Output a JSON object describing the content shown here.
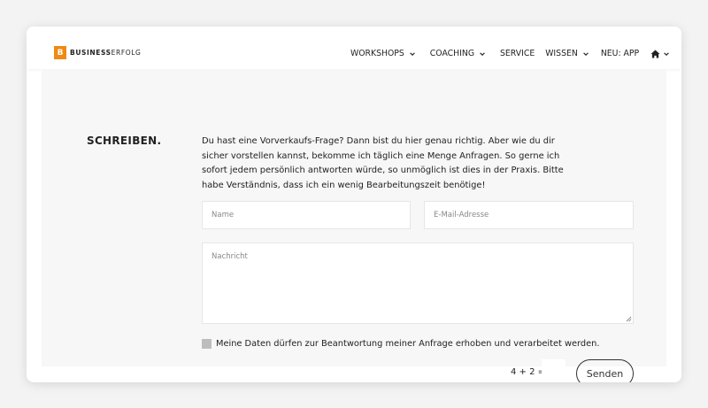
{
  "brand": {
    "badge": "B",
    "name_bold": "BUSINESS",
    "name_light": "ERFOLG",
    "accent_color": "#f08a13"
  },
  "nav": {
    "items": [
      {
        "label": "WORKSHOPS",
        "has_dropdown": true
      },
      {
        "label": "COACHING",
        "has_dropdown": true
      },
      {
        "label": "SERVICE",
        "has_dropdown": false
      },
      {
        "label": "WISSEN",
        "has_dropdown": true
      },
      {
        "label": "NEU: APP",
        "has_dropdown": false
      }
    ],
    "home_icon": "home-icon"
  },
  "contact": {
    "title": "SCHREIBEN.",
    "intro": "Du hast eine Vorverkaufs-Frage? Dann bist du hier genau richtig. Aber wie du dir sicher vorstellen kannst, bekomme ich täglich eine Menge Anfragen. So gerne ich sofort jedem persönlich antworten würde, so unmöglich ist dies in der Praxis. Bitte habe Verständnis, dass ich ein wenig Bearbeitungszeit benötige!",
    "name_placeholder": "Name",
    "email_placeholder": "E-Mail-Adresse",
    "message_placeholder": "Nachricht",
    "consent_label": "Meine Daten dürfen zur Beantwortung meiner Anfrage erhoben und verarbeitet werden.",
    "captcha_question": "4 + 2 =",
    "submit_label": "Senden"
  }
}
